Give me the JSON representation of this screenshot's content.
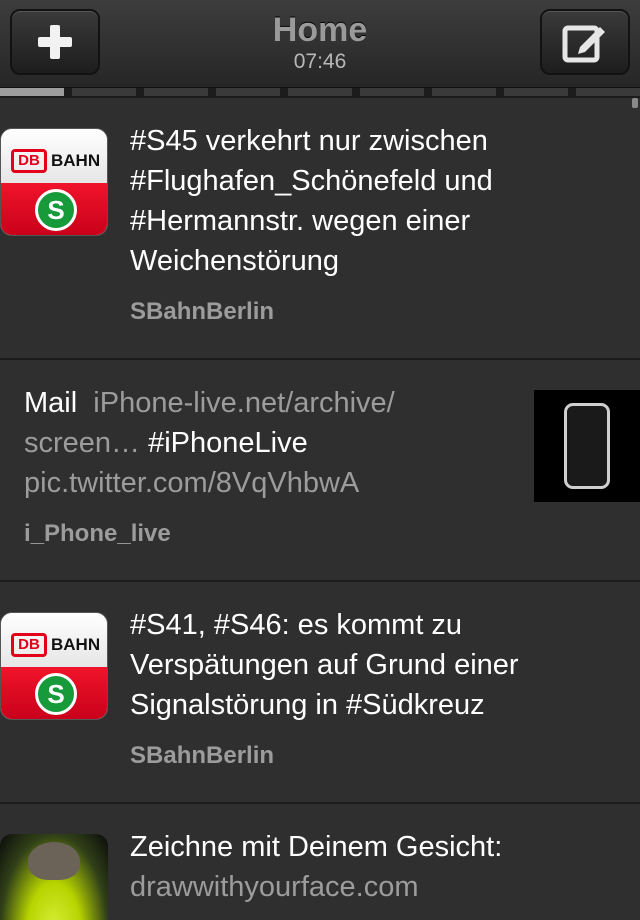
{
  "header": {
    "title": "Home",
    "time": "07:46",
    "compose_icon": "plus-icon",
    "edit_icon": "compose-icon"
  },
  "tabs": {
    "count": 9,
    "active_index": 0
  },
  "tweets": [
    {
      "avatar": "db-sbahn-logo",
      "lines": [
        "#S45 verkehrt nur zwischen",
        "#Flughafen_Schönefeld und",
        "#Hermannstr. wegen einer",
        "Weichenstörung"
      ],
      "author": "SBahnBerlin"
    },
    {
      "line1_text": "Mail",
      "line1_link": "iPhone-live.net/archive/",
      "line2_link": "screen…",
      "line2_text": "#iPhoneLive",
      "line3_link": "pic.twitter.com/8VqVhbwA",
      "author": "i_Phone_live",
      "thumbnail": "phone-icon"
    },
    {
      "avatar": "db-sbahn-logo",
      "lines": [
        "#S41, #S46: es kommt zu",
        "Verspätungen auf Grund einer",
        "Signalstörung in #Südkreuz"
      ],
      "author": "SBahnBerlin"
    },
    {
      "avatar": "photo",
      "line1": "Zeichne mit Deinem Gesicht:",
      "line2_link": "drawwithyourface.com"
    }
  ],
  "db_logo": {
    "db": "DB",
    "bahn": "BAHN",
    "s": "S"
  },
  "colors": {
    "background": "#2e2e2e",
    "link": "#9c9c9c",
    "db_red": "#e2001a",
    "sbahn_green": "#169a3a"
  }
}
